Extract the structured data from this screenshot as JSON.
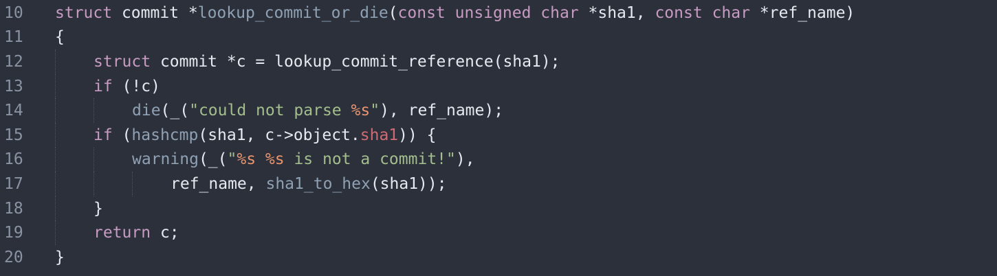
{
  "editor": {
    "background": "#2b303b",
    "colors": {
      "keyword": "#c79bc2",
      "function": "#8fa1b3",
      "string": "#a3be8c",
      "format_specifier": "#e8946f",
      "member": "#d06b73",
      "plain": "#e6e9ef",
      "line_number": "#8b93a3"
    },
    "lines": [
      {
        "number": "10",
        "indent": 0,
        "tokens": [
          {
            "t": "struct",
            "k": "kw"
          },
          {
            "t": " commit *",
            "k": "plain"
          },
          {
            "t": "lookup_commit_or_die",
            "k": "fn"
          },
          {
            "t": "(",
            "k": "plain"
          },
          {
            "t": "const",
            "k": "kw"
          },
          {
            "t": " ",
            "k": "plain"
          },
          {
            "t": "unsigned",
            "k": "kw"
          },
          {
            "t": " ",
            "k": "plain"
          },
          {
            "t": "char",
            "k": "kw"
          },
          {
            "t": " *sha1, ",
            "k": "plain"
          },
          {
            "t": "const",
            "k": "kw"
          },
          {
            "t": " ",
            "k": "plain"
          },
          {
            "t": "char",
            "k": "kw"
          },
          {
            "t": " *ref_name)",
            "k": "plain"
          }
        ]
      },
      {
        "number": "11",
        "indent": 0,
        "tokens": [
          {
            "t": "{",
            "k": "plain"
          }
        ]
      },
      {
        "number": "12",
        "indent": 1,
        "tokens": [
          {
            "t": "struct",
            "k": "kw"
          },
          {
            "t": " commit *c = lookup_commit_reference(sha1);",
            "k": "plain"
          }
        ]
      },
      {
        "number": "13",
        "indent": 1,
        "tokens": [
          {
            "t": "if",
            "k": "kw"
          },
          {
            "t": " (!c)",
            "k": "plain"
          }
        ]
      },
      {
        "number": "14",
        "indent": 2,
        "tokens": [
          {
            "t": "die",
            "k": "fn"
          },
          {
            "t": "(_(",
            "k": "plain"
          },
          {
            "t": "\"could not parse ",
            "k": "str"
          },
          {
            "t": "%s",
            "k": "fmt"
          },
          {
            "t": "\"",
            "k": "str"
          },
          {
            "t": "), ref_name);",
            "k": "plain"
          }
        ]
      },
      {
        "number": "15",
        "indent": 1,
        "tokens": [
          {
            "t": "if",
            "k": "kw"
          },
          {
            "t": " (",
            "k": "plain"
          },
          {
            "t": "hashcmp",
            "k": "fn"
          },
          {
            "t": "(sha1, c->object.",
            "k": "plain"
          },
          {
            "t": "sha1",
            "k": "mem"
          },
          {
            "t": ")) {",
            "k": "plain"
          }
        ]
      },
      {
        "number": "16",
        "indent": 2,
        "tokens": [
          {
            "t": "warning",
            "k": "fn"
          },
          {
            "t": "(_(",
            "k": "plain"
          },
          {
            "t": "\"",
            "k": "str"
          },
          {
            "t": "%s",
            "k": "fmt"
          },
          {
            "t": " ",
            "k": "str"
          },
          {
            "t": "%s",
            "k": "fmt"
          },
          {
            "t": " is not a commit!\"",
            "k": "str"
          },
          {
            "t": "),",
            "k": "plain"
          }
        ]
      },
      {
        "number": "17",
        "indent": 3,
        "tokens": [
          {
            "t": "ref_name, ",
            "k": "plain"
          },
          {
            "t": "sha1_to_hex",
            "k": "fn"
          },
          {
            "t": "(sha1));",
            "k": "plain"
          }
        ]
      },
      {
        "number": "18",
        "indent": 1,
        "tokens": [
          {
            "t": "}",
            "k": "plain"
          }
        ]
      },
      {
        "number": "19",
        "indent": 1,
        "tokens": [
          {
            "t": "return",
            "k": "kw"
          },
          {
            "t": " c;",
            "k": "plain"
          }
        ]
      },
      {
        "number": "20",
        "indent": 0,
        "tokens": [
          {
            "t": "}",
            "k": "plain"
          }
        ]
      }
    ]
  }
}
